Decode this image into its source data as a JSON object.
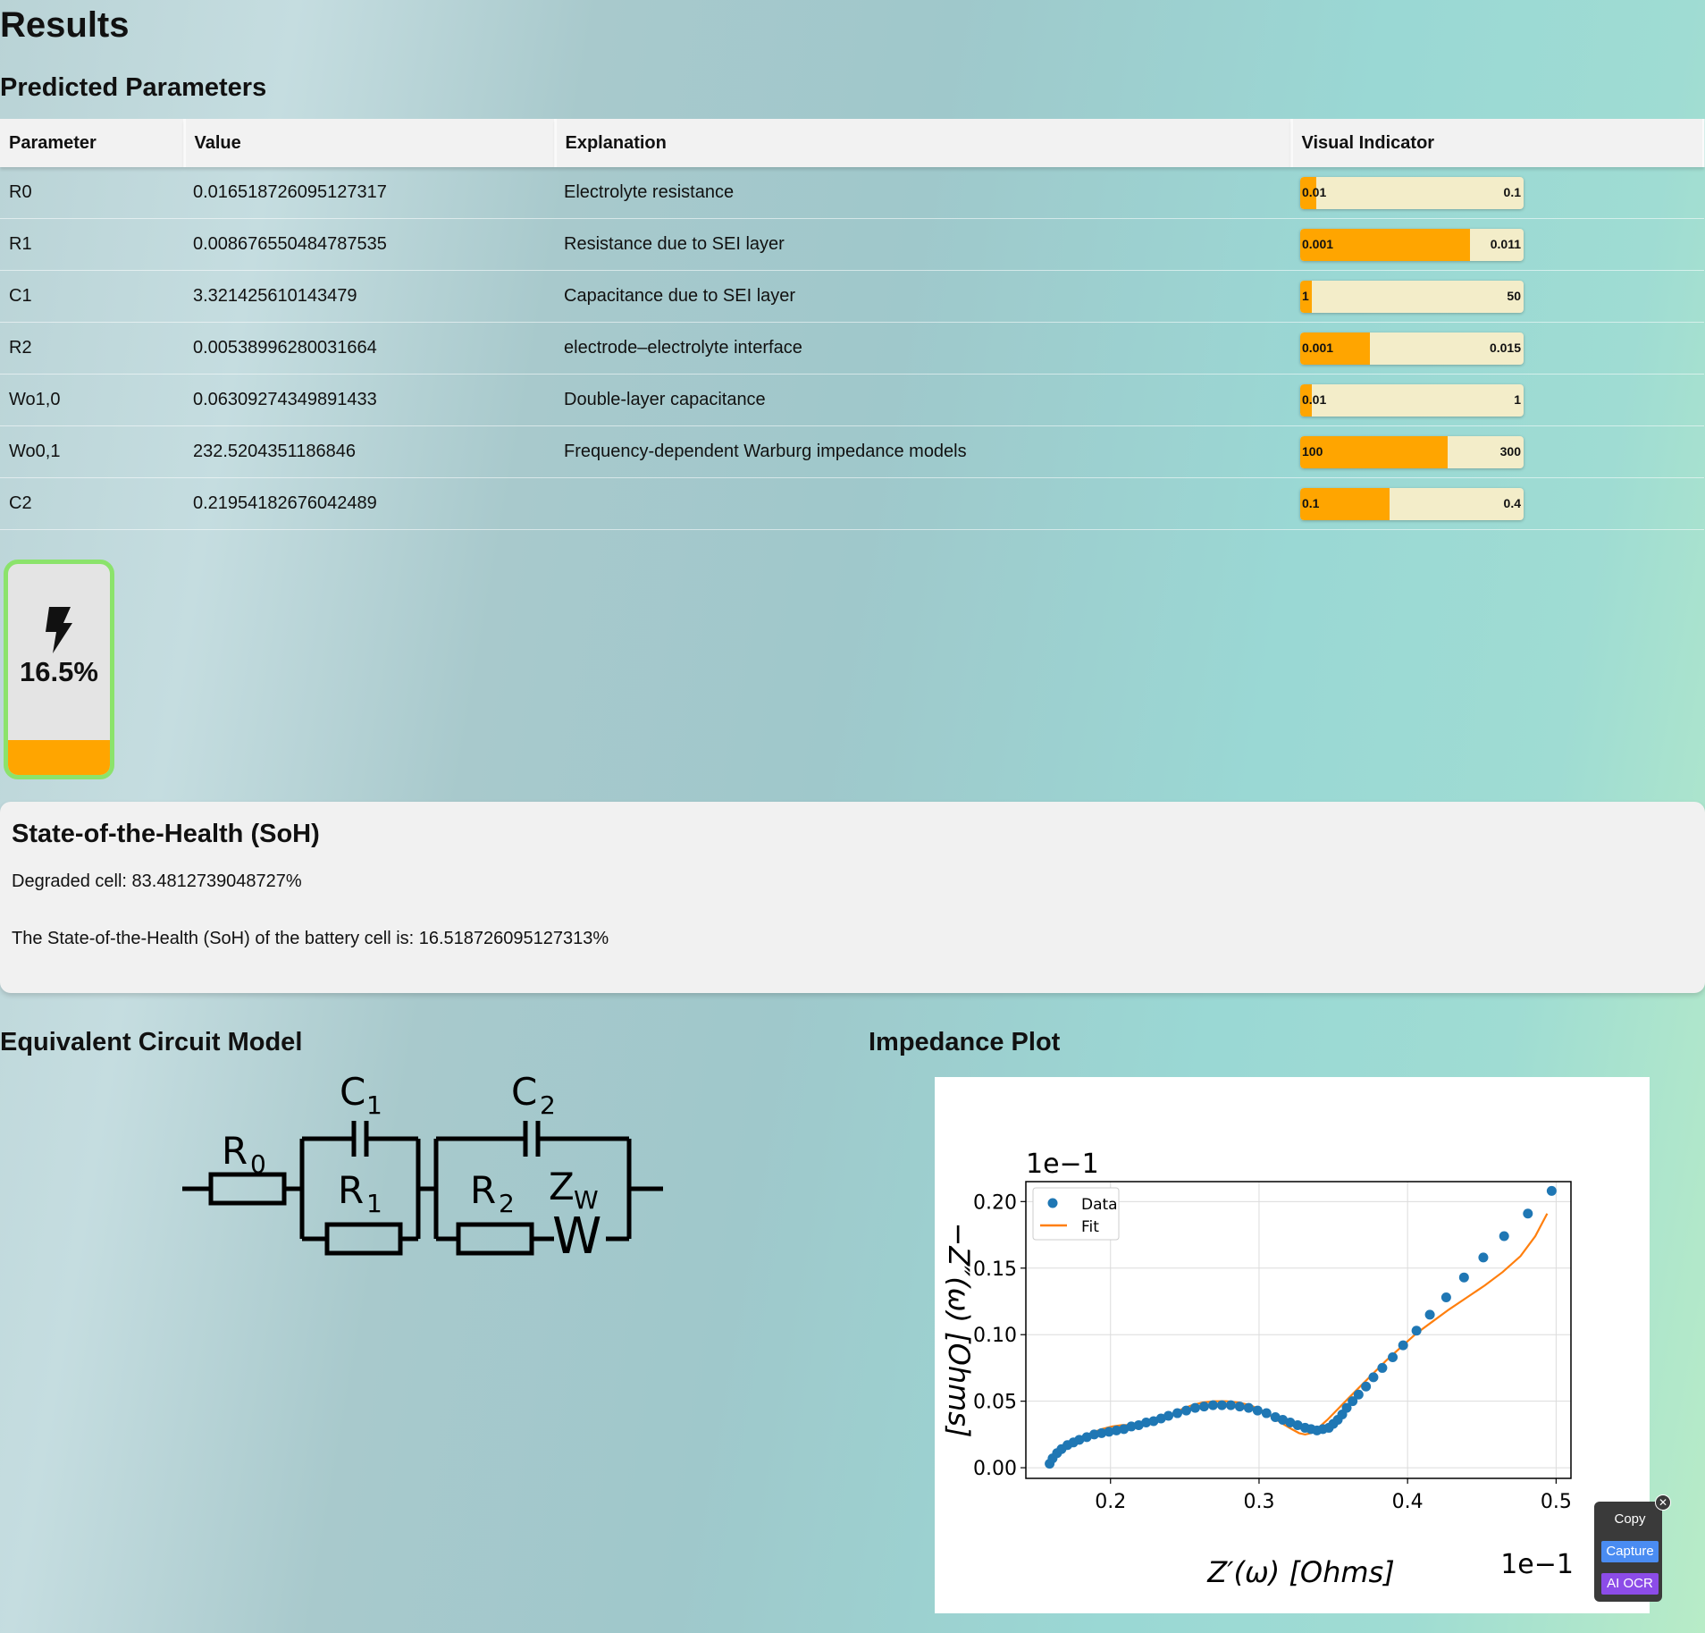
{
  "page": {
    "title": "Results",
    "predicted_title": "Predicted Parameters"
  },
  "table": {
    "headers": [
      "Parameter",
      "Value",
      "Explanation",
      "Visual Indicator"
    ],
    "rows": [
      {
        "param": "R0",
        "value": "0.016518726095127317",
        "explanation": "Electrolyte resistance",
        "min": "0.01",
        "max": "0.1",
        "fill": 0.07
      },
      {
        "param": "R1",
        "value": "0.008676550484787535",
        "explanation": "Resistance due to SEI layer",
        "min": "0.001",
        "max": "0.011",
        "fill": 0.76
      },
      {
        "param": "C1",
        "value": "3.321425610143479",
        "explanation": "Capacitance due to SEI layer",
        "min": "1",
        "max": "50",
        "fill": 0.05
      },
      {
        "param": "R2",
        "value": "0.00538996280031664",
        "explanation": "electrode–electrolyte interface",
        "min": "0.001",
        "max": "0.015",
        "fill": 0.31
      },
      {
        "param": "Wo1,0",
        "value": "0.06309274349891433",
        "explanation": "Double-layer capacitance",
        "min": "0.01",
        "max": "1",
        "fill": 0.05
      },
      {
        "param": "Wo0,1",
        "value": "232.5204351186846",
        "explanation": "Frequency-dependent Warburg impedance models",
        "min": "100",
        "max": "300",
        "fill": 0.66
      },
      {
        "param": "C2",
        "value": "0.21954182676042489",
        "explanation": "",
        "min": "0.1",
        "max": "0.4",
        "fill": 0.4
      }
    ]
  },
  "battery": {
    "percent_text": "16.5%",
    "level": 0.165,
    "fill_color": "#ffa500",
    "border_color": "#8be36b",
    "icon": "lightning-bolt-icon"
  },
  "soh": {
    "title": "State-of-the-Health (SoH)",
    "degraded": "Degraded cell: 83.4812739048727%",
    "statement": "The State-of-the-Health (SoH) of the battery cell is: 16.518726095127313%"
  },
  "circuit": {
    "title": "Equivalent Circuit Model",
    "labels": {
      "r0": "R",
      "r0_sub": "0",
      "c1": "C",
      "c1_sub": "1",
      "r1": "R",
      "r1_sub": "1",
      "c2": "C",
      "c2_sub": "2",
      "r2": "R",
      "r2_sub": "2",
      "zw": "Z",
      "zw_sub": "W",
      "w": "W"
    }
  },
  "impedance": {
    "title": "Impedance Plot"
  },
  "chart_data": {
    "type": "scatter",
    "title": "",
    "xlabel": "Z′(ω) [Ohms]",
    "ylabel": "−Z″(ω) [Ohms]",
    "x_offset_label": "1e−1",
    "y_offset_label": "1e−1",
    "xlim": [
      0.143,
      0.51
    ],
    "ylim": [
      -0.008,
      0.215
    ],
    "xticks": [
      0.2,
      0.3,
      0.4,
      0.5
    ],
    "xtick_labels": [
      "0.2",
      "0.3",
      "0.4",
      "0.5"
    ],
    "yticks": [
      0.0,
      0.05,
      0.1,
      0.15,
      0.2
    ],
    "ytick_labels": [
      "0.00",
      "0.05",
      "0.10",
      "0.15",
      "0.20"
    ],
    "grid": true,
    "legend": "upper-left",
    "series": [
      {
        "name": "Data",
        "kind": "scatter",
        "color": "#1f77b4",
        "x": [
          0.159,
          0.161,
          0.164,
          0.167,
          0.171,
          0.175,
          0.179,
          0.184,
          0.189,
          0.194,
          0.199,
          0.204,
          0.209,
          0.214,
          0.219,
          0.224,
          0.229,
          0.234,
          0.239,
          0.245,
          0.251,
          0.257,
          0.263,
          0.269,
          0.275,
          0.281,
          0.287,
          0.293,
          0.299,
          0.305,
          0.311,
          0.316,
          0.321,
          0.326,
          0.331,
          0.335,
          0.339,
          0.343,
          0.347,
          0.35,
          0.353,
          0.356,
          0.359,
          0.363,
          0.367,
          0.372,
          0.377,
          0.383,
          0.39,
          0.397,
          0.406,
          0.415,
          0.426,
          0.438,
          0.451,
          0.465,
          0.481,
          0.497
        ],
        "y": [
          0.003,
          0.007,
          0.011,
          0.014,
          0.017,
          0.019,
          0.021,
          0.023,
          0.025,
          0.026,
          0.027,
          0.028,
          0.029,
          0.031,
          0.032,
          0.034,
          0.035,
          0.037,
          0.039,
          0.041,
          0.043,
          0.045,
          0.046,
          0.047,
          0.047,
          0.047,
          0.046,
          0.045,
          0.043,
          0.041,
          0.038,
          0.036,
          0.034,
          0.032,
          0.03,
          0.029,
          0.028,
          0.029,
          0.03,
          0.033,
          0.036,
          0.04,
          0.045,
          0.05,
          0.055,
          0.061,
          0.068,
          0.075,
          0.083,
          0.092,
          0.103,
          0.115,
          0.128,
          0.143,
          0.158,
          0.174,
          0.191,
          0.208
        ]
      },
      {
        "name": "Fit",
        "kind": "line",
        "color": "#ff7f0e",
        "x": [
          0.159,
          0.163,
          0.168,
          0.174,
          0.18,
          0.187,
          0.194,
          0.201,
          0.208,
          0.215,
          0.221,
          0.227,
          0.234,
          0.241,
          0.248,
          0.255,
          0.262,
          0.27,
          0.278,
          0.286,
          0.294,
          0.302,
          0.309,
          0.316,
          0.322,
          0.327,
          0.331,
          0.335,
          0.34,
          0.346,
          0.353,
          0.36,
          0.368,
          0.377,
          0.386,
          0.396,
          0.406,
          0.417,
          0.428,
          0.44,
          0.452,
          0.464,
          0.476,
          0.486,
          0.494
        ],
        "y": [
          0.002,
          0.008,
          0.013,
          0.018,
          0.022,
          0.026,
          0.029,
          0.031,
          0.032,
          0.032,
          0.032,
          0.033,
          0.036,
          0.04,
          0.044,
          0.047,
          0.049,
          0.05,
          0.05,
          0.049,
          0.047,
          0.043,
          0.038,
          0.033,
          0.029,
          0.026,
          0.025,
          0.026,
          0.03,
          0.036,
          0.044,
          0.052,
          0.061,
          0.071,
          0.081,
          0.091,
          0.101,
          0.11,
          0.119,
          0.128,
          0.137,
          0.147,
          0.159,
          0.174,
          0.191
        ]
      }
    ]
  },
  "widget": {
    "copy": "Copy",
    "capture": "Capture",
    "ocr": "AI OCR",
    "close": "✕"
  }
}
